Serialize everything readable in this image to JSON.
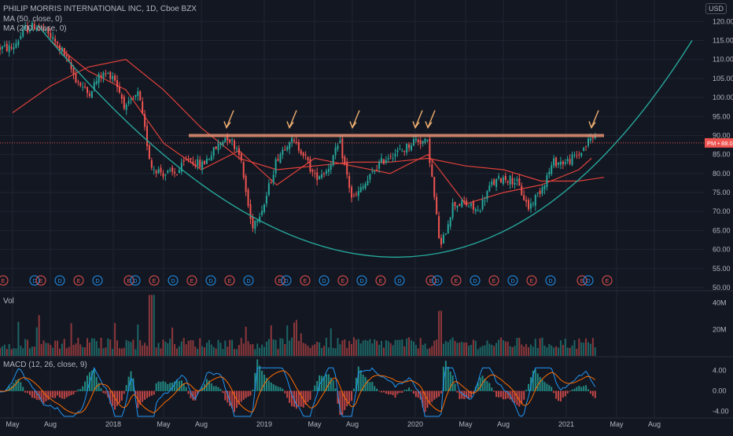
{
  "header": {
    "title_line": "PHILIP MORRIS INTERNATIONAL INC, 1D, Cboe BZX",
    "ma50": "MA (50, close, 0)",
    "ma200": "MA (200, close, 0)",
    "currency": "USD"
  },
  "panes": {
    "volume_label": "Vol",
    "macd_label": "MACD (12, 26, close, 9)"
  },
  "colors": {
    "background": "#131722",
    "up": "#26a69a",
    "down": "#ef5350",
    "ma": "#e0413a",
    "cup_curve": "#26a69a",
    "resistance": "#e89173",
    "arrow": "#f0b070",
    "macd_line": "#2196f3",
    "signal_line": "#ff6d00",
    "grid": "#1f2433"
  },
  "chart_data": {
    "type": "candlestick",
    "symbol": "PM",
    "interval": "1D",
    "price_axis": {
      "ticks": [
        "120.00",
        "115.00",
        "110.00",
        "105.00",
        "100.00",
        "95.00",
        "90.00",
        "85.00",
        "80.00",
        "75.00",
        "70.00",
        "65.00",
        "60.00",
        "55.00",
        "50.00"
      ],
      "range": [
        50,
        124
      ]
    },
    "time_axis": {
      "ticks": [
        "May",
        "Aug",
        "2018",
        "May",
        "Aug",
        "2019",
        "May",
        "Aug",
        "2020",
        "May",
        "Aug",
        "2021",
        "May",
        "Aug"
      ]
    },
    "last_price": {
      "symbol": "PM",
      "value": "88.05"
    },
    "resistance_level": 90,
    "price_path": [
      [
        "2017-05",
        113
      ],
      [
        "2017-06",
        118
      ],
      [
        "2017-07",
        119
      ],
      [
        "2017-08",
        116
      ],
      [
        "2017-09",
        112
      ],
      [
        "2017-10",
        105
      ],
      [
        "2017-11",
        101
      ],
      [
        "2017-12",
        106
      ],
      [
        "2018-01",
        106
      ],
      [
        "2018-02",
        97
      ],
      [
        "2018-03",
        101
      ],
      [
        "2018-04",
        82
      ],
      [
        "2018-05",
        80
      ],
      [
        "2018-06",
        80
      ],
      [
        "2018-07",
        84
      ],
      [
        "2018-08",
        82
      ],
      [
        "2018-09",
        86
      ],
      [
        "2018-10",
        90
      ],
      [
        "2018-11",
        86
      ],
      [
        "2018-12",
        66
      ],
      [
        "2019-01",
        72
      ],
      [
        "2019-02",
        84
      ],
      [
        "2019-03",
        89
      ],
      [
        "2019-04",
        86
      ],
      [
        "2019-05",
        79
      ],
      [
        "2019-06",
        81
      ],
      [
        "2019-07",
        88
      ],
      [
        "2019-08",
        73
      ],
      [
        "2019-09",
        77
      ],
      [
        "2019-10",
        82
      ],
      [
        "2019-11",
        85
      ],
      [
        "2019-12",
        86
      ],
      [
        "2020-01",
        89
      ],
      [
        "2020-02",
        88
      ],
      [
        "2020-03",
        60
      ],
      [
        "2020-04",
        72
      ],
      [
        "2020-05",
        72
      ],
      [
        "2020-06",
        70
      ],
      [
        "2020-07",
        77
      ],
      [
        "2020-08",
        79
      ],
      [
        "2020-09",
        78
      ],
      [
        "2020-10",
        71
      ],
      [
        "2020-11",
        76
      ],
      [
        "2020-12",
        83
      ],
      [
        "2021-01",
        83
      ],
      [
        "2021-02",
        85
      ],
      [
        "2021-03",
        89.5
      ]
    ],
    "moving_averages": [
      {
        "name": "MA (50, close, 0)",
        "path": [
          [
            "2017-08",
            115
          ],
          [
            "2017-11",
            107
          ],
          [
            "2018-02",
            102
          ],
          [
            "2018-05",
            88
          ],
          [
            "2018-08",
            81
          ],
          [
            "2018-11",
            86
          ],
          [
            "2019-02",
            77
          ],
          [
            "2019-05",
            84
          ],
          [
            "2019-08",
            82
          ],
          [
            "2019-11",
            80
          ],
          [
            "2020-02",
            85
          ],
          [
            "2020-05",
            72
          ],
          [
            "2020-08",
            75
          ],
          [
            "2020-11",
            77
          ],
          [
            "2021-02",
            81
          ],
          [
            "2021-03",
            84
          ]
        ]
      },
      {
        "name": "MA (200, close, 0)",
        "path": [
          [
            "2017-05",
            96
          ],
          [
            "2017-08",
            103
          ],
          [
            "2017-11",
            108
          ],
          [
            "2018-02",
            110
          ],
          [
            "2018-05",
            102
          ],
          [
            "2018-08",
            92
          ],
          [
            "2018-11",
            84
          ],
          [
            "2019-02",
            81
          ],
          [
            "2019-05",
            82
          ],
          [
            "2019-08",
            83
          ],
          [
            "2019-11",
            83
          ],
          [
            "2020-02",
            84
          ],
          [
            "2020-05",
            82
          ],
          [
            "2020-08",
            81
          ],
          [
            "2020-11",
            78
          ],
          [
            "2021-02",
            78
          ],
          [
            "2021-04",
            79
          ]
        ]
      }
    ],
    "cup_curve": {
      "from": [
        "2017-07",
        119
      ],
      "bottom": [
        "2019-11",
        58
      ],
      "to": [
        "2021-11",
        115
      ]
    },
    "arrows": [
      "2018-10",
      "2019-03",
      "2019-08",
      "2020-01",
      "2020-02",
      "2021-03"
    ],
    "event_markers": [
      {
        "date": "2017-04",
        "kind": "E"
      },
      {
        "date": "2017-07",
        "kind": "D"
      },
      {
        "date": "2017-07",
        "kind": "E"
      },
      {
        "date": "2017-09",
        "kind": "D"
      },
      {
        "date": "2017-10",
        "kind": "E"
      },
      {
        "date": "2017-12",
        "kind": "D"
      },
      {
        "date": "2018-02",
        "kind": "E"
      },
      {
        "date": "2018-03",
        "kind": "D"
      },
      {
        "date": "2018-04",
        "kind": "E"
      },
      {
        "date": "2018-06",
        "kind": "D"
      },
      {
        "date": "2018-07",
        "kind": "E"
      },
      {
        "date": "2018-09",
        "kind": "D"
      },
      {
        "date": "2018-10",
        "kind": "E"
      },
      {
        "date": "2018-12",
        "kind": "D"
      },
      {
        "date": "2019-02",
        "kind": "E"
      },
      {
        "date": "2019-03",
        "kind": "D"
      },
      {
        "date": "2019-04",
        "kind": "E"
      },
      {
        "date": "2019-06",
        "kind": "D"
      },
      {
        "date": "2019-07",
        "kind": "E"
      },
      {
        "date": "2019-09",
        "kind": "D"
      },
      {
        "date": "2019-10",
        "kind": "E"
      },
      {
        "date": "2019-12",
        "kind": "D"
      },
      {
        "date": "2020-02",
        "kind": "E"
      },
      {
        "date": "2020-03",
        "kind": "D"
      },
      {
        "date": "2020-04",
        "kind": "E"
      },
      {
        "date": "2020-06",
        "kind": "D"
      },
      {
        "date": "2020-07",
        "kind": "E"
      },
      {
        "date": "2020-09",
        "kind": "D"
      },
      {
        "date": "2020-10",
        "kind": "E"
      },
      {
        "date": "2020-12",
        "kind": "D"
      },
      {
        "date": "2021-02",
        "kind": "E"
      },
      {
        "date": "2021-03",
        "kind": "D"
      },
      {
        "date": "2021-04",
        "kind": "E"
      }
    ],
    "volume_axis": {
      "ticks": [
        "40M",
        "20M"
      ]
    },
    "macd_axis": {
      "ticks": [
        "4.00",
        "0.00",
        "-4.00"
      ]
    }
  }
}
